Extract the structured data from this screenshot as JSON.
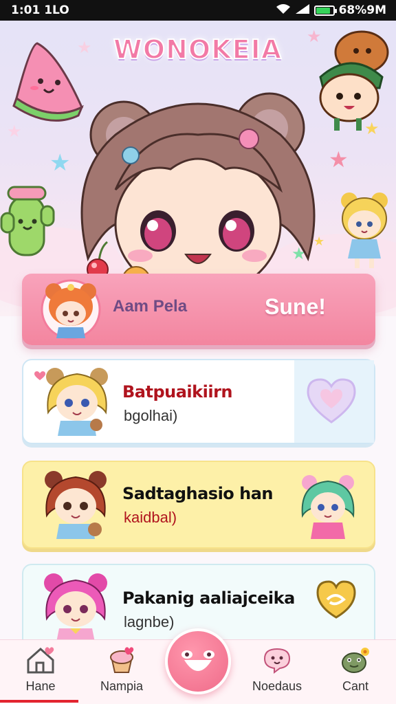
{
  "status_bar": {
    "time": "1:01 1LO",
    "battery": "68%9M",
    "battery_level": 0.85
  },
  "app": {
    "logo": "WONOKEIA"
  },
  "profile_card": {
    "name": "Aam Pela",
    "action": "Sune!"
  },
  "list": [
    {
      "title": "Batpuaikiirn",
      "subtitle": "bgolhai)",
      "title_color": "#b0141e"
    },
    {
      "title": "Sadtaghasio han",
      "subtitle": "kaidbal)",
      "title_color": "#111111"
    },
    {
      "title": "Pakanig aaliajceika",
      "subtitle": "lagnbe)",
      "title_color": "#111111"
    }
  ],
  "nav": [
    {
      "label": "Hane",
      "icon": "home-heart-icon"
    },
    {
      "label": "Nampia",
      "icon": "cupcake-heart-icon"
    },
    {
      "label": "Noedaus",
      "icon": "chat-heart-icon"
    },
    {
      "label": "Cant",
      "icon": "frog-flower-icon"
    }
  ],
  "colors": {
    "accent": "#f3859f",
    "active_indicator": "#e2242f",
    "card_yellow": "#fdf0a8"
  }
}
